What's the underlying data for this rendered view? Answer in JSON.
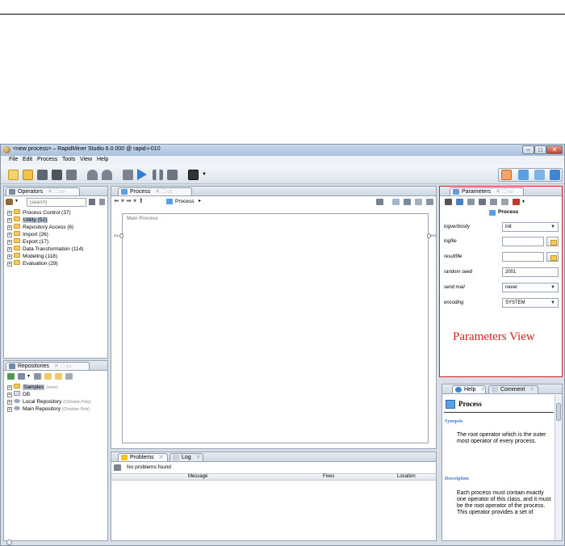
{
  "window": {
    "title": "<new process> – RapidMiner Studio 6.0.000 @ rapid-i-010",
    "minimize": "–",
    "maximize": "□",
    "close": "✕"
  },
  "menu": [
    "File",
    "Edit",
    "Process",
    "Tools",
    "View",
    "Help"
  ],
  "operators": {
    "tab_label": "Operators",
    "search_placeholder": "[search]",
    "tree": [
      {
        "label": "Process Control (37)",
        "selected": false
      },
      {
        "label": "Utility (52)",
        "selected": true
      },
      {
        "label": "Repository Access (6)",
        "selected": false
      },
      {
        "label": "Import (26)",
        "selected": false
      },
      {
        "label": "Export (17)",
        "selected": false
      },
      {
        "label": "Data Transformation (114)",
        "selected": false
      },
      {
        "label": "Modeling (118)",
        "selected": false
      },
      {
        "label": "Evaluation (29)",
        "selected": false
      }
    ]
  },
  "repositories": {
    "tab_label": "Repositories",
    "tree": [
      {
        "label": "Samples",
        "owner": "(none)",
        "selected": true
      },
      {
        "label": "DB",
        "owner": "",
        "selected": false
      },
      {
        "label": "Local Repository",
        "owner": "(Christian Pels)",
        "selected": false
      },
      {
        "label": "Main Repository",
        "owner": "(Christian Pels)",
        "selected": false
      }
    ]
  },
  "process": {
    "tab_label": "Process",
    "breadcrumb": "Process",
    "canvas_title": "Main Process",
    "port_in": "inp",
    "port_out": "res"
  },
  "problems": {
    "tab_label": "Problems",
    "log_tab_label": "Log",
    "status": "No problems found",
    "columns": [
      "Message",
      "Fixes",
      "Location"
    ]
  },
  "parameters": {
    "tab_label": "Parameters",
    "operator_name": "Process",
    "annotation": "Parameters View",
    "fields": [
      {
        "label": "logverbosity",
        "value": "init",
        "kind": "combo"
      },
      {
        "label": "logfile",
        "value": "",
        "kind": "file"
      },
      {
        "label": "resultfile",
        "value": "",
        "kind": "file"
      },
      {
        "label": "random seed",
        "value": "2001",
        "kind": "text"
      },
      {
        "label": "send mail",
        "value": "never",
        "kind": "combo"
      },
      {
        "label": "encoding",
        "value": "SYSTEM",
        "kind": "combo"
      }
    ]
  },
  "help": {
    "tab_label": "Help",
    "comment_tab_label": "Comment",
    "title": "Process",
    "synopsis_heading": "Synopsis",
    "synopsis": "The root operator which is the outer most operator of every process.",
    "description_heading": "Description",
    "description": "Each process must contain exactly one operator of this class, and it must be the root operator of the process. This operator provides a set of"
  },
  "colors": {
    "annotation_red": "#d62020",
    "window_frame": "#a9c0dc",
    "highlight": "#b8c2d0",
    "help_heading": "#3a7ad1"
  }
}
